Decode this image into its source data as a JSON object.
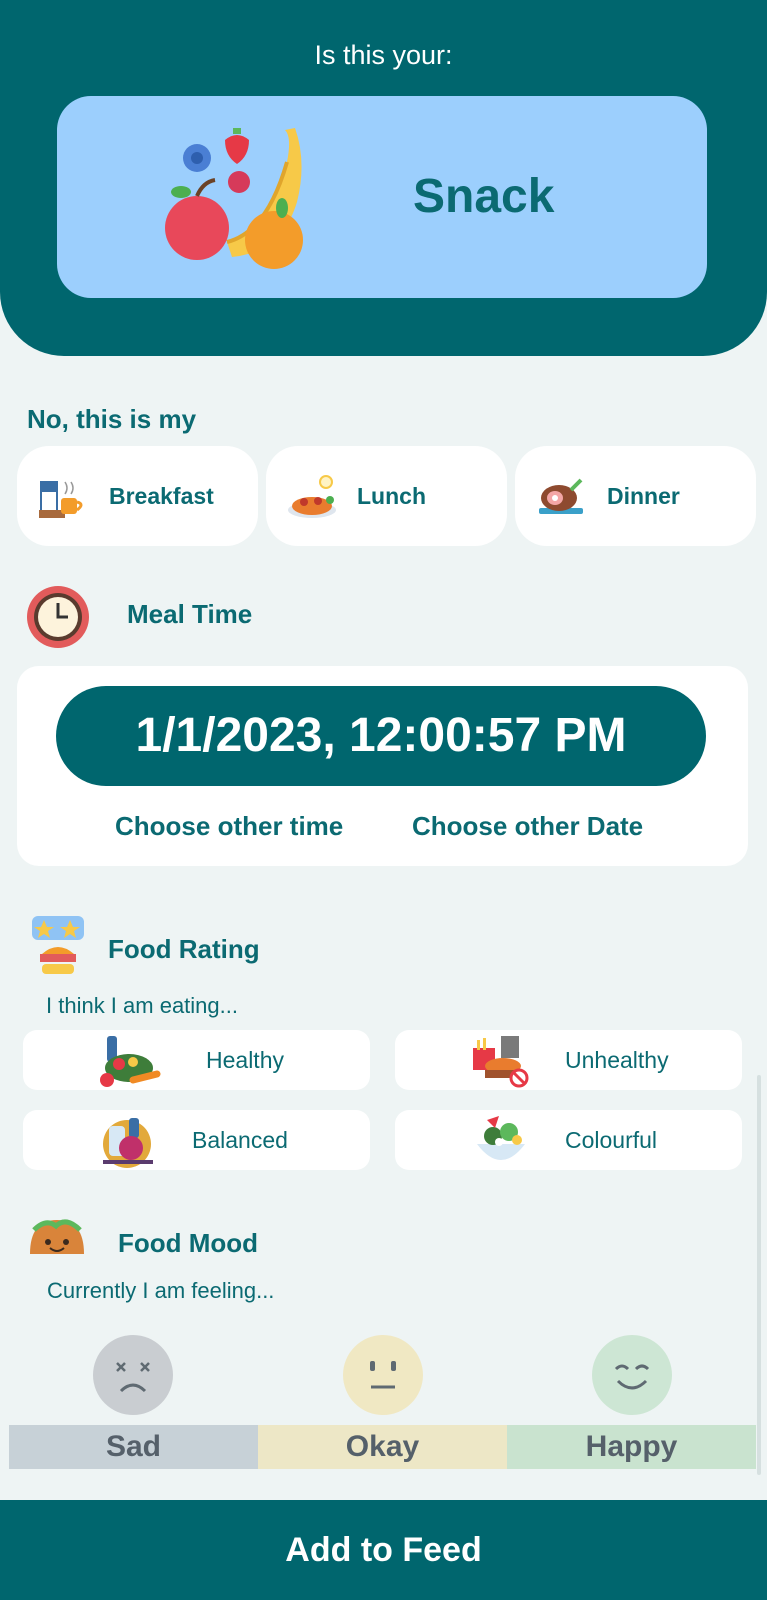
{
  "header": {
    "question": "Is this your:",
    "meal": "Snack"
  },
  "alternatives": {
    "title": "No, this is my",
    "items": [
      {
        "label": "Breakfast",
        "icon": "breakfast-icon"
      },
      {
        "label": "Lunch",
        "icon": "lunch-icon"
      },
      {
        "label": "Dinner",
        "icon": "dinner-icon"
      }
    ]
  },
  "meal_time": {
    "title": "Meal Time",
    "value": "1/1/2023, 12:00:57 PM",
    "choose_time": "Choose other time",
    "choose_date": "Choose other Date"
  },
  "food_rating": {
    "title": "Food Rating",
    "prompt": "I think I am eating...",
    "options": [
      {
        "label": "Healthy",
        "icon": "healthy-food-icon"
      },
      {
        "label": "Unhealthy",
        "icon": "unhealthy-food-icon"
      },
      {
        "label": "Balanced",
        "icon": "balanced-food-icon"
      },
      {
        "label": "Colourful",
        "icon": "colourful-food-icon"
      }
    ]
  },
  "food_mood": {
    "title": "Food Mood",
    "prompt": "Currently I am feeling...",
    "options": [
      {
        "label": "Sad",
        "color": "#c7d1d7",
        "face_color": "#c9cdd1"
      },
      {
        "label": "Okay",
        "color": "#ede7c6",
        "face_color": "#f0e8c3"
      },
      {
        "label": "Happy",
        "color": "#c9e3cf",
        "face_color": "#cde6d4"
      }
    ]
  },
  "footer": {
    "button": "Add to Feed"
  },
  "colors": {
    "primary": "#00666e",
    "card_blue": "#9ccffd",
    "background": "#eef4f4"
  }
}
